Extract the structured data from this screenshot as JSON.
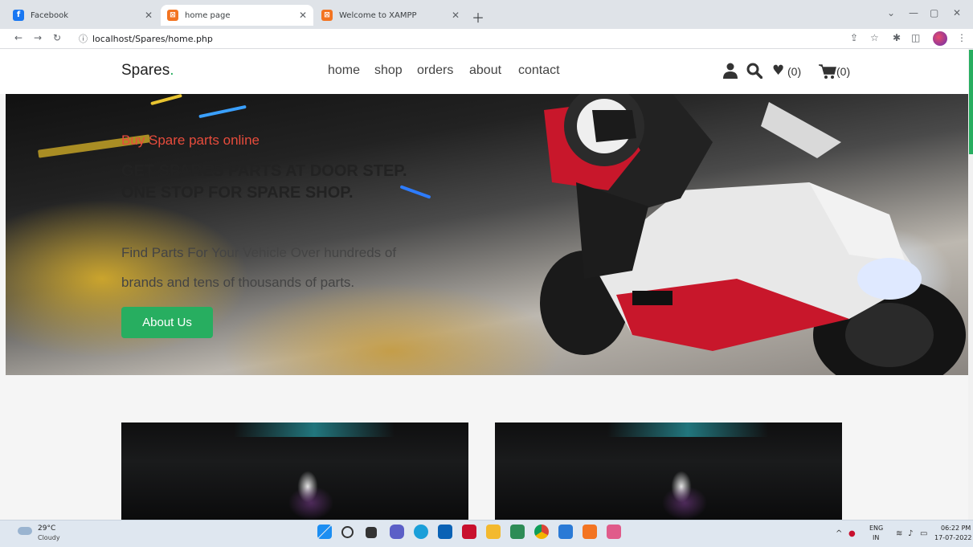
{
  "browser": {
    "tabs": [
      {
        "title": "Facebook",
        "icon": "facebook-icon"
      },
      {
        "title": "home page",
        "icon": "xampp-icon"
      },
      {
        "title": "Welcome to XAMPP",
        "icon": "xampp-icon"
      }
    ],
    "active_tab": 1,
    "url": "localhost/Spares/home.php"
  },
  "site": {
    "logo": "Spares",
    "logo_dot": ".",
    "nav": [
      "home",
      "shop",
      "orders",
      "about",
      "contact"
    ],
    "wishlist_count": "(0)",
    "cart_count": "(0)",
    "accent_color": "#27ae60"
  },
  "hero": {
    "subtitle": "Buy Spare parts online",
    "title": "GET SPARES PARTS AT DOOR STEP. ONE STOP FOR SPARE SHOP.",
    "description": "Find Parts For Your Vehicle Over hundreds of brands and tens of thousands of parts.",
    "button": "About Us"
  },
  "taskbar": {
    "temperature": "29°C",
    "weather": "Cloudy",
    "lang": "ENG",
    "region": "IN",
    "time": "06:22 PM",
    "date": "17-07-2022"
  }
}
